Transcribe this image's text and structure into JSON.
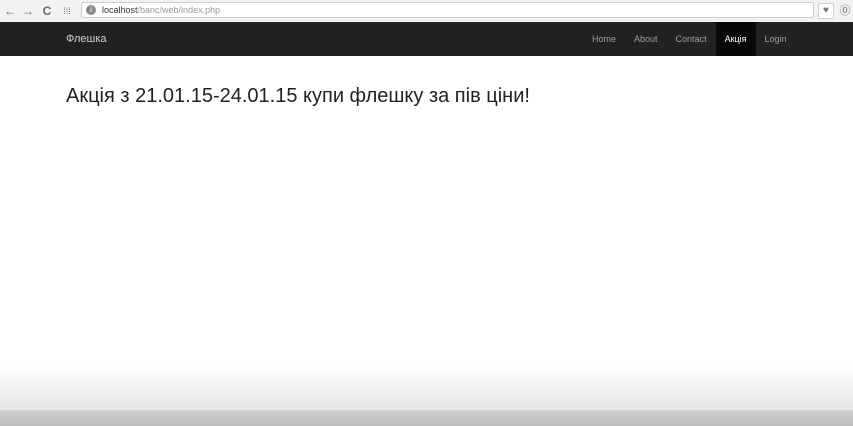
{
  "browser": {
    "back_icon": "←",
    "forward_icon": "→",
    "reload_icon": "C",
    "apps_icon": "⁞⁞⁞",
    "url_host": "localhost",
    "url_path": "/banc/web/index.php",
    "pocket_icon": "♥",
    "download_icon": "⓪"
  },
  "navbar": {
    "brand": "Флешка",
    "items": [
      {
        "label": "Home",
        "active": false
      },
      {
        "label": "About",
        "active": false
      },
      {
        "label": "Contact",
        "active": false
      },
      {
        "label": "Акція",
        "active": true
      },
      {
        "label": "Login",
        "active": false
      }
    ]
  },
  "main": {
    "headline": "Акція з 21.01.15-24.01.15 купи флешку за пів ціни!"
  }
}
